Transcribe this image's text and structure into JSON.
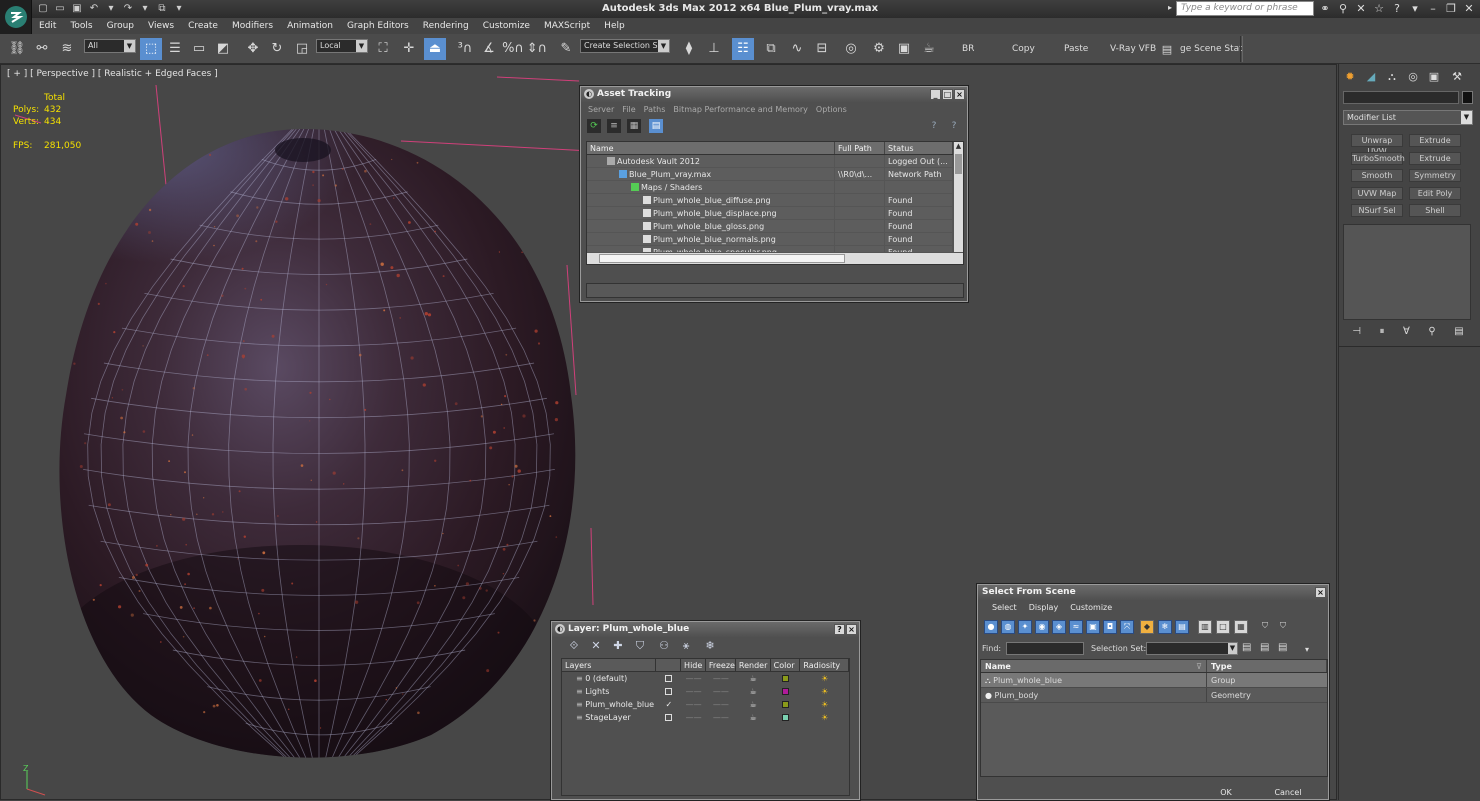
{
  "app": {
    "title": "Autodesk 3ds Max  2012 x64      Blue_Plum_vray.max",
    "search_placeholder": "Type a keyword or phrase"
  },
  "menu": [
    "Edit",
    "Tools",
    "Group",
    "Views",
    "Create",
    "Modifiers",
    "Animation",
    "Graph Editors",
    "Rendering",
    "Customize",
    "MAXScript",
    "Help"
  ],
  "toolbar": {
    "selection_filter": "All",
    "coord_system": "Local",
    "selection_set": "Create Selection Se",
    "br_label": "BR",
    "copy_label": "Copy",
    "paste_label": "Paste",
    "vray_label": "V-Ray VFB",
    "scene_state_label": "ge Scene Stat"
  },
  "viewport": {
    "label": "[ + ] [ Perspective ] [ Realistic + Edged Faces ]",
    "stats_header": "Total",
    "polys_label": "Polys:",
    "polys_value": "432",
    "verts_label": "Verts:",
    "verts_value": "434",
    "fps_label": "FPS:",
    "fps_value": "281,050"
  },
  "asset_tracking": {
    "title": "Asset Tracking",
    "menu": [
      "Server",
      "File",
      "Paths",
      "Bitmap Performance and Memory",
      "Options"
    ],
    "columns": [
      "Name",
      "Full Path",
      "Status"
    ],
    "rows": [
      {
        "name": "Autodesk Vault 2012",
        "path": "",
        "status": "Logged Out (...",
        "indent": 0,
        "icon": "vault-icon"
      },
      {
        "name": "Blue_Plum_vray.max",
        "path": "\\\\R0\\d\\...",
        "status": "Network Path",
        "indent": 1,
        "icon": "max-file-icon"
      },
      {
        "name": "Maps / Shaders",
        "path": "",
        "status": "",
        "indent": 2,
        "icon": "maps-icon"
      },
      {
        "name": "Plum_whole_blue_diffuse.png",
        "path": "",
        "status": "Found",
        "indent": 3,
        "icon": "bitmap-icon"
      },
      {
        "name": "Plum_whole_blue_displace.png",
        "path": "",
        "status": "Found",
        "indent": 3,
        "icon": "bitmap-icon"
      },
      {
        "name": "Plum_whole_blue_gloss.png",
        "path": "",
        "status": "Found",
        "indent": 3,
        "icon": "bitmap-icon"
      },
      {
        "name": "Plum_whole_blue_normals.png",
        "path": "",
        "status": "Found",
        "indent": 3,
        "icon": "bitmap-icon"
      },
      {
        "name": "Plum_whole_blue_specular.png",
        "path": "",
        "status": "Found",
        "indent": 3,
        "icon": "bitmap-icon"
      }
    ]
  },
  "layer_window": {
    "title": "Layer: Plum_whole_blue",
    "columns": [
      "Layers",
      "Hide",
      "Freeze",
      "Render",
      "Color",
      "Radiosity"
    ],
    "rows": [
      {
        "name": "0 (default)",
        "active": false,
        "color": "#8a9a1a"
      },
      {
        "name": "Lights",
        "active": false,
        "color": "#b01a9a"
      },
      {
        "name": "Plum_whole_blue",
        "active": true,
        "color": "#8a9a1a"
      },
      {
        "name": "StageLayer",
        "active": false,
        "color": "#7ad0b0"
      }
    ]
  },
  "select_from_scene": {
    "title": "Select From Scene",
    "menu": [
      "Select",
      "Display",
      "Customize"
    ],
    "find_label": "Find:",
    "selection_set_label": "Selection Set:",
    "columns": [
      "Name",
      "Type"
    ],
    "rows": [
      {
        "name": "Plum_whole_blue",
        "type": "Group",
        "selected": true
      },
      {
        "name": "Plum_body",
        "type": "Geometry",
        "selected": false
      }
    ],
    "ok_label": "OK",
    "cancel_label": "Cancel"
  },
  "command_panel": {
    "modifier_list": "Modifier List",
    "buttons": [
      "Unwrap UVW",
      "Extrude",
      "TurboSmooth",
      "Extrude",
      "Smooth",
      "Symmetry",
      "UVW Map",
      "Edit Poly",
      "NSurf Sel",
      "Shell"
    ]
  }
}
